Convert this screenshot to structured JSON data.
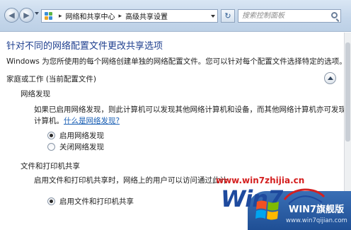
{
  "address_bar": {
    "back_icon": "back-arrow-icon",
    "forward_icon": "forward-arrow-icon",
    "breadcrumbs": [
      "网络和共享中心",
      "高级共享设置"
    ],
    "search_placeholder": "搜索控制面板"
  },
  "page": {
    "title": "针对不同的网络配置文件更改共享选项",
    "description": "Windows 为您所使用的每个网络创建单独的网络配置文件。您可以针对每个配置文件选择特定的选项。",
    "profile_section": "家庭或工作 (当前配置文件)",
    "network_discovery": {
      "heading": "网络发现",
      "text_line1": "如果已启用网络发现，则此计算机可以发现其他网络计算机和设备，而其他网络计算机亦可发现此",
      "text_line2": "计算机。",
      "link": "什么是网络发现?",
      "options": [
        "启用网络发现",
        "关闭网络发现"
      ],
      "selected": "启用网络发现"
    },
    "file_printer_sharing": {
      "heading": "文件和打印机共享",
      "text": "启用文件和打印机共享时，网络上的用户可以访问通过此计",
      "options": [
        "启用文件和打印机共享"
      ],
      "selected": "启用文件和打印机共享"
    }
  },
  "watermark": {
    "url": "www.win7zhijia.cn",
    "big_text": "Win7",
    "brand": "WIN7旗舰版",
    "site": "www.win7qijian.com"
  },
  "colors": {
    "title_blue": "#1e3f8f",
    "link_blue": "#1a5fb4",
    "watermark_red": "#d42020",
    "badge_blue": "#1f4f95"
  }
}
